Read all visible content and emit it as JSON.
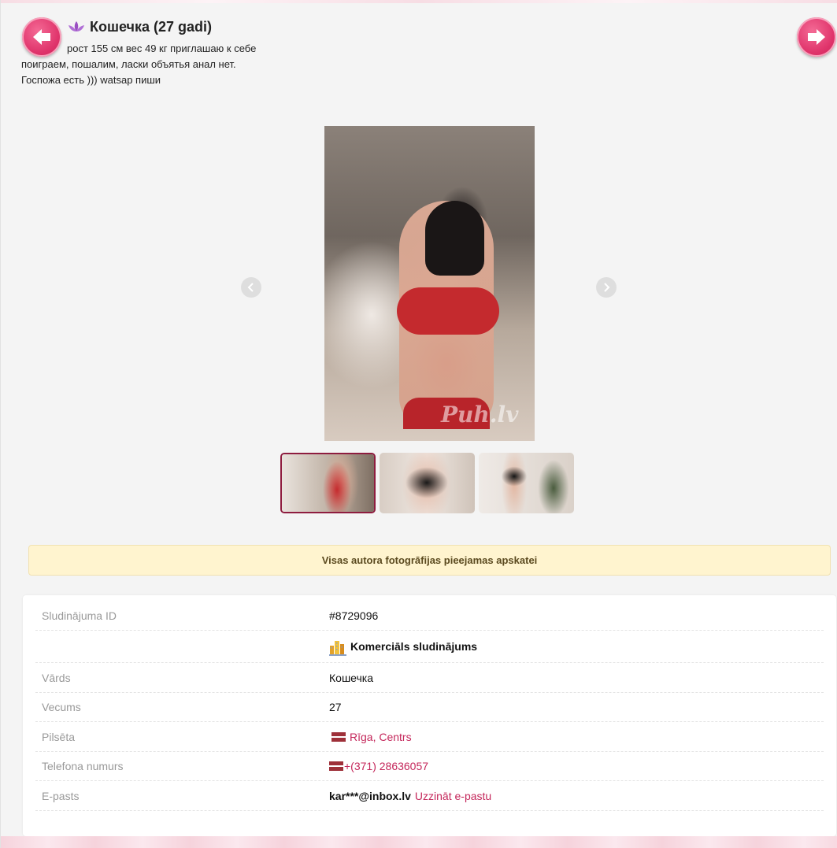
{
  "header": {
    "title": "Кошечка (27 gadi)",
    "description": "рост 155 см вес 49 кг приглашаю к себе поиграем, пошалим, ласки объятья анал нет. Госпожа есть ))) watsap пиши",
    "prev_icon": "arrow-left-icon",
    "next_icon": "arrow-right-icon",
    "title_icon": "lotus-icon"
  },
  "gallery": {
    "watermark": "Puh.lv",
    "thumbnails_count": 3,
    "selected_index": 0
  },
  "notice": {
    "text": "Visas autora fotogrāfijas pieejamas apskatei"
  },
  "details": {
    "ad_id_label": "Sludinājuma ID",
    "ad_id_value": "#8729096",
    "commercial_label": "Komerciāls sludinājums",
    "name_label": "Vārds",
    "name_value": "Кошечка",
    "age_label": "Vecums",
    "age_value": "27",
    "city_label": "Pilsēta",
    "city_value": "Rīga, Centrs",
    "phone_label": "Telefona numurs",
    "phone_value": "+(371) 28636057",
    "email_label": "E-pasts",
    "email_value": "kar***@inbox.lv",
    "email_link": "Uzzināt e-pastu"
  },
  "colors": {
    "accent": "#e0356c",
    "link": "#c4265a",
    "notice_bg": "#fff4cf",
    "flag_red": "#9e3039",
    "flag_white": "#ffffff"
  }
}
